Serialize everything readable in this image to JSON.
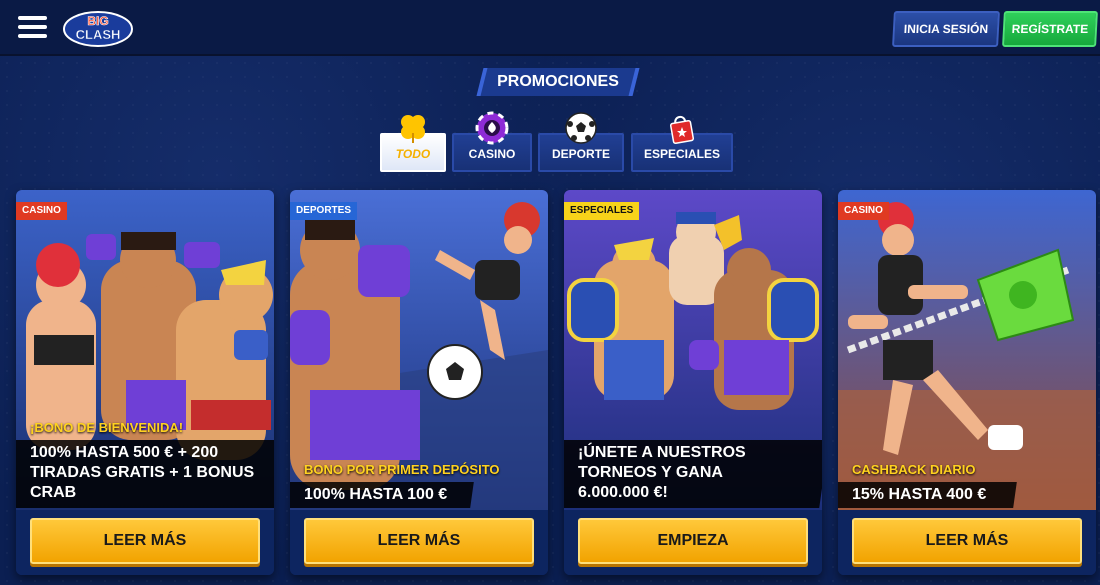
{
  "header": {
    "logo_text_1": "BIG",
    "logo_text_2": "CLASH",
    "login_label": "INICIA SESIÓN",
    "register_label": "REGÍSTRATE"
  },
  "section_title": "PROMOCIONES",
  "filters": [
    {
      "label": "TODO",
      "icon": "clover-icon",
      "active": true
    },
    {
      "label": "CASINO",
      "icon": "poker-chip-icon",
      "active": false
    },
    {
      "label": "DEPORTE",
      "icon": "soccer-ball-icon",
      "active": false
    },
    {
      "label": "ESPECIALES",
      "icon": "gift-bag-icon",
      "active": false
    }
  ],
  "cards": [
    {
      "badge": "CASINO",
      "subtitle": "¡BONO DE BIENVENIDA!",
      "headline_1": "100% HASTA 500 € + 200",
      "headline_2": "TIRADAS GRATIS + 1 BONUS",
      "headline_3": "CRAB",
      "cta": "LEER MÁS"
    },
    {
      "badge": "DEPORTES",
      "subtitle": "BONO POR PRIMER DEPÓSITO",
      "headline_1": "100% HASTA 100 €",
      "cta": "LEER MÁS"
    },
    {
      "badge": "ESPECIALES",
      "headline_1": "¡ÚNETE A NUESTROS",
      "headline_2": "TORNEOS Y GANA",
      "headline_3": "6.000.000 €!",
      "cta": "EMPIEZA"
    },
    {
      "badge": "CASINO",
      "subtitle": "CASHBACK DIARIO",
      "headline_1": "15% HASTA 400 €",
      "cta": "LEER MÁS"
    }
  ],
  "colors": {
    "background": "#0b1f52",
    "accent_yellow": "#f2a300",
    "register_green": "#16a83c",
    "badge_red": "#e03a22",
    "badge_blue": "#2666d6",
    "badge_yellow": "#f7d31a"
  }
}
